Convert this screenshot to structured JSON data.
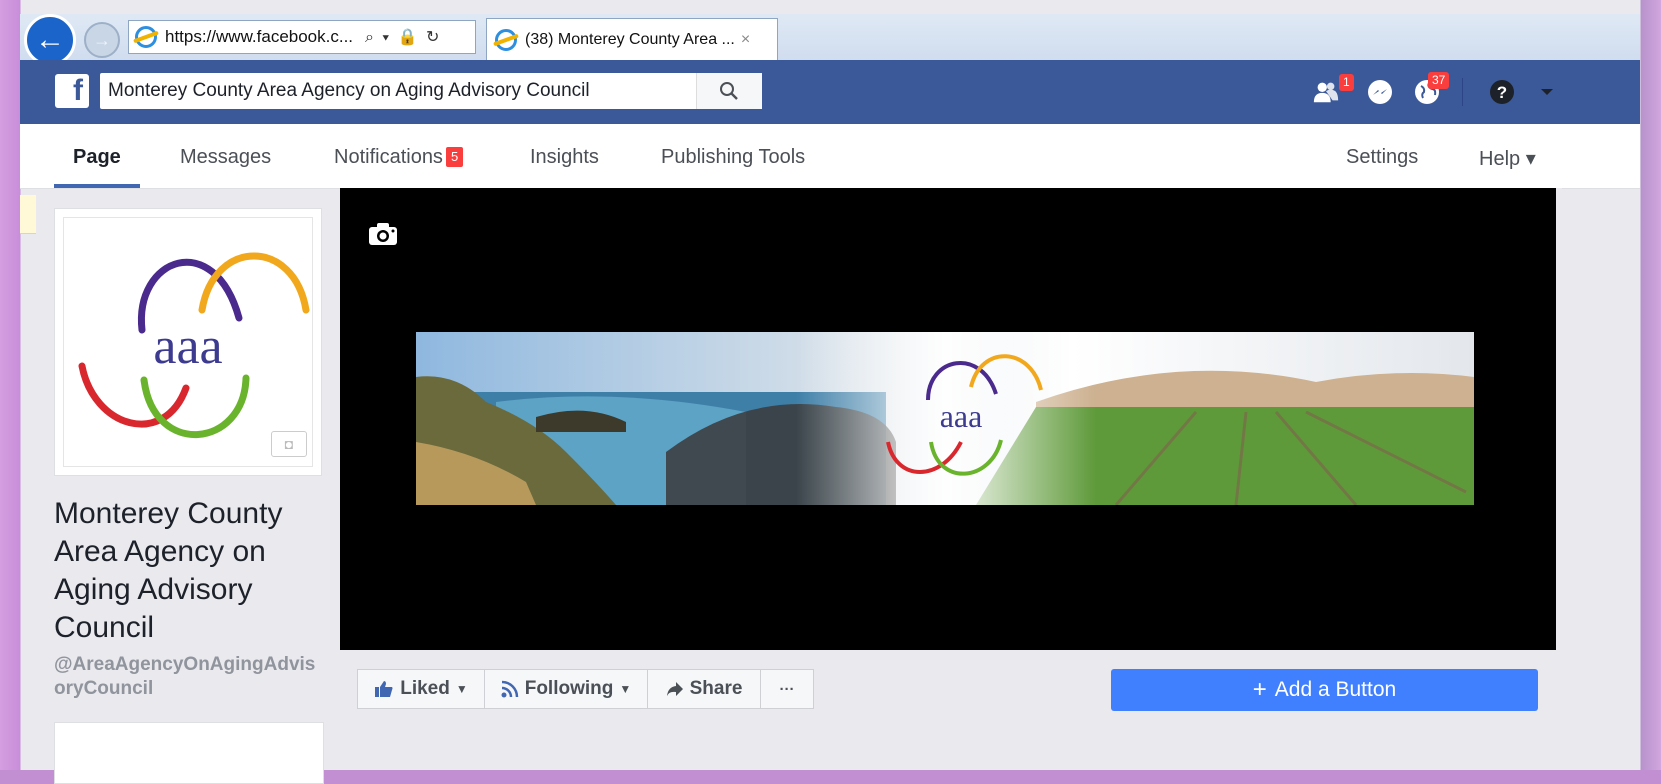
{
  "browser": {
    "address_url": "https://www.facebook.c...",
    "address_tools": "⌕ ▾ 🔒 ↻",
    "tab_title": "(38) Monterey County Area ...",
    "tab_close": "×"
  },
  "header": {
    "logo": "f",
    "search_value": "Monterey County Area Agency on Aging Advisory Council",
    "friends_badge": "1",
    "notifications_badge": "37"
  },
  "page_nav": {
    "page": "Page",
    "messages": "Messages",
    "notifications": "Notifications",
    "notifications_badge": "5",
    "insights": "Insights",
    "publishing_tools": "Publishing Tools",
    "settings": "Settings",
    "help": "Help ▾"
  },
  "profile": {
    "logo_text": "aaa",
    "name": "Monterey County Area Agency on Aging Advisory Council",
    "handle": "@AreaAgencyOnAgingAdvisoryCouncil"
  },
  "cover": {
    "logo_text": "aaa"
  },
  "actions": {
    "liked": "Liked",
    "following": "Following",
    "share": "Share",
    "more": "···",
    "add_button": "Add a Button"
  },
  "colors": {
    "facebook_blue": "#3b5998",
    "button_blue": "#4080ff",
    "badge_red": "#fa3e3e"
  }
}
